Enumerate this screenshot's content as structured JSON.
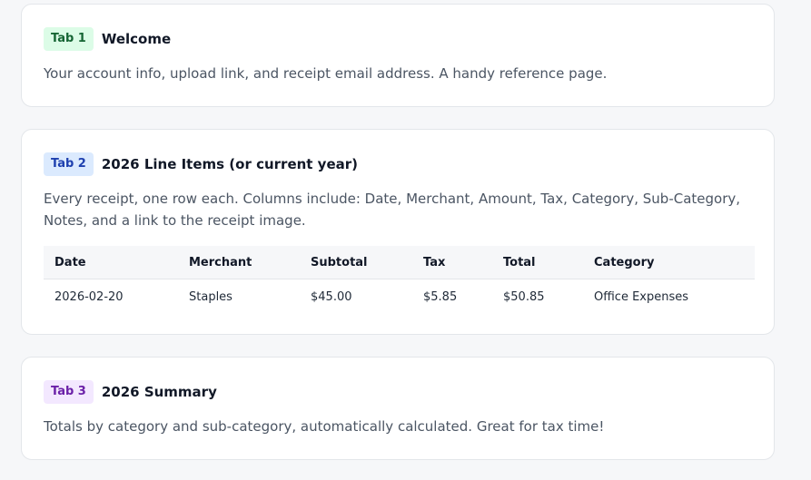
{
  "cards": [
    {
      "badge": "Tab 1",
      "title": "Welcome",
      "description": "Your account info, upload link, and receipt email address. A handy reference page."
    },
    {
      "badge": "Tab 2",
      "title": "2026 Line Items (or current year)",
      "description": "Every receipt, one row each. Columns include: Date, Merchant, Amount, Tax, Category, Sub-Category, Notes, and a link to the receipt image.",
      "table": {
        "headers": [
          "Date",
          "Merchant",
          "Subtotal",
          "Tax",
          "Total",
          "Category"
        ],
        "rows": [
          [
            "2026-02-20",
            "Staples",
            "$45.00",
            "$5.85",
            "$50.85",
            "Office Expenses"
          ]
        ]
      }
    },
    {
      "badge": "Tab 3",
      "title": "2026 Summary",
      "description": "Totals by category and sub-category, automatically calculated. Great for tax time!"
    }
  ],
  "colors": {
    "page_bg": "#f6f7f9",
    "card_bg": "#ffffff",
    "badge_green_bg": "#dcfce7",
    "badge_blue_bg": "#dbeafe",
    "badge_purple_bg": "#f3e8ff"
  }
}
